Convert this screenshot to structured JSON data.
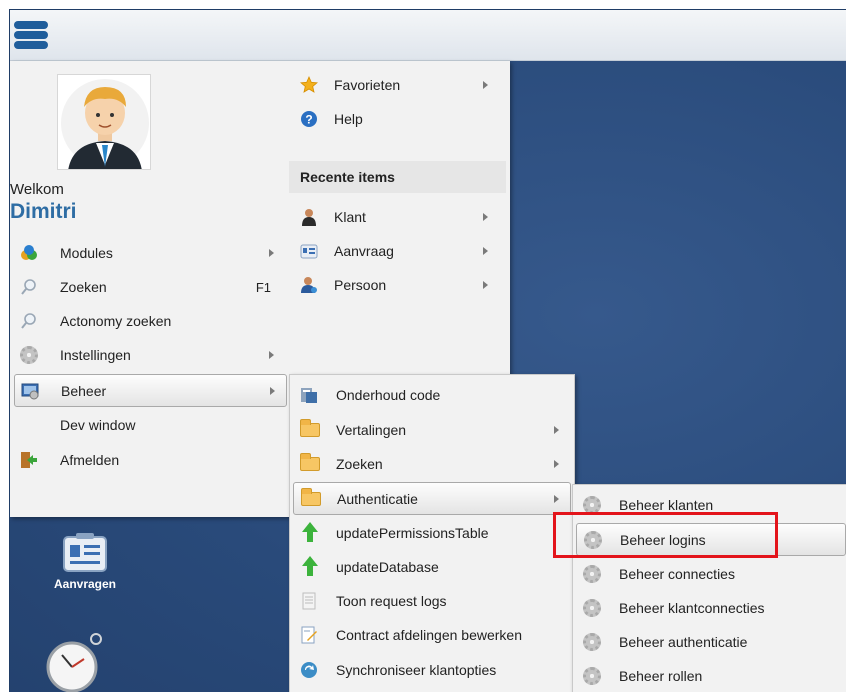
{
  "user": {
    "welcome": "Welkom",
    "name": "Dimitri"
  },
  "main_menu": [
    {
      "label": "Modules",
      "shortcut": "",
      "has_submenu": true,
      "icon": "modules-icon"
    },
    {
      "label": "Zoeken",
      "shortcut": "F1",
      "has_submenu": false,
      "icon": "search-icon"
    },
    {
      "label": "Actonomy zoeken",
      "shortcut": "",
      "has_submenu": false,
      "icon": "search-icon"
    },
    {
      "label": "Instellingen",
      "shortcut": "",
      "has_submenu": true,
      "icon": "gear-icon"
    },
    {
      "label": "Beheer",
      "shortcut": "",
      "has_submenu": true,
      "icon": "admin-icon",
      "active": true
    },
    {
      "label": "Dev window",
      "shortcut": "",
      "has_submenu": false,
      "icon": ""
    },
    {
      "label": "Afmelden",
      "shortcut": "",
      "has_submenu": false,
      "icon": "logout-icon"
    }
  ],
  "right_column": {
    "favorites": "Favorieten",
    "help": "Help",
    "recent_header": "Recente items",
    "recent": [
      "Klant",
      "Aanvraag",
      "Persoon"
    ]
  },
  "beheer_submenu": [
    {
      "label": "Onderhoud code",
      "icon": "code-icon",
      "has_submenu": false
    },
    {
      "label": "Vertalingen",
      "icon": "folder-icon",
      "has_submenu": true
    },
    {
      "label": "Zoeken",
      "icon": "folder-icon",
      "has_submenu": true
    },
    {
      "label": "Authenticatie",
      "icon": "folder-icon",
      "has_submenu": true,
      "active": true
    },
    {
      "label": "updatePermissionsTable",
      "icon": "up-arrow-icon",
      "has_submenu": false
    },
    {
      "label": "updateDatabase",
      "icon": "up-arrow-icon",
      "has_submenu": false
    },
    {
      "label": "Toon request logs",
      "icon": "document-icon",
      "has_submenu": false
    },
    {
      "label": "Contract afdelingen bewerken",
      "icon": "edit-icon",
      "has_submenu": false
    },
    {
      "label": "Synchroniseer klantopties",
      "icon": "sync-icon",
      "has_submenu": false
    }
  ],
  "auth_submenu": [
    {
      "label": "Beheer klanten",
      "icon": "gear-icon"
    },
    {
      "label": "Beheer logins",
      "icon": "gear-icon",
      "highlighted": true
    },
    {
      "label": "Beheer connecties",
      "icon": "gear-icon"
    },
    {
      "label": "Beheer klantconnecties",
      "icon": "gear-icon"
    },
    {
      "label": "Beheer authenticatie",
      "icon": "gear-icon"
    },
    {
      "label": "Beheer rollen",
      "icon": "gear-icon"
    }
  ],
  "desktop": {
    "aanvragen_label": "Aanvragen"
  },
  "colors": {
    "accent": "#2e6da4",
    "desktop": "#2c4f82",
    "highlight": "#e3141b"
  }
}
